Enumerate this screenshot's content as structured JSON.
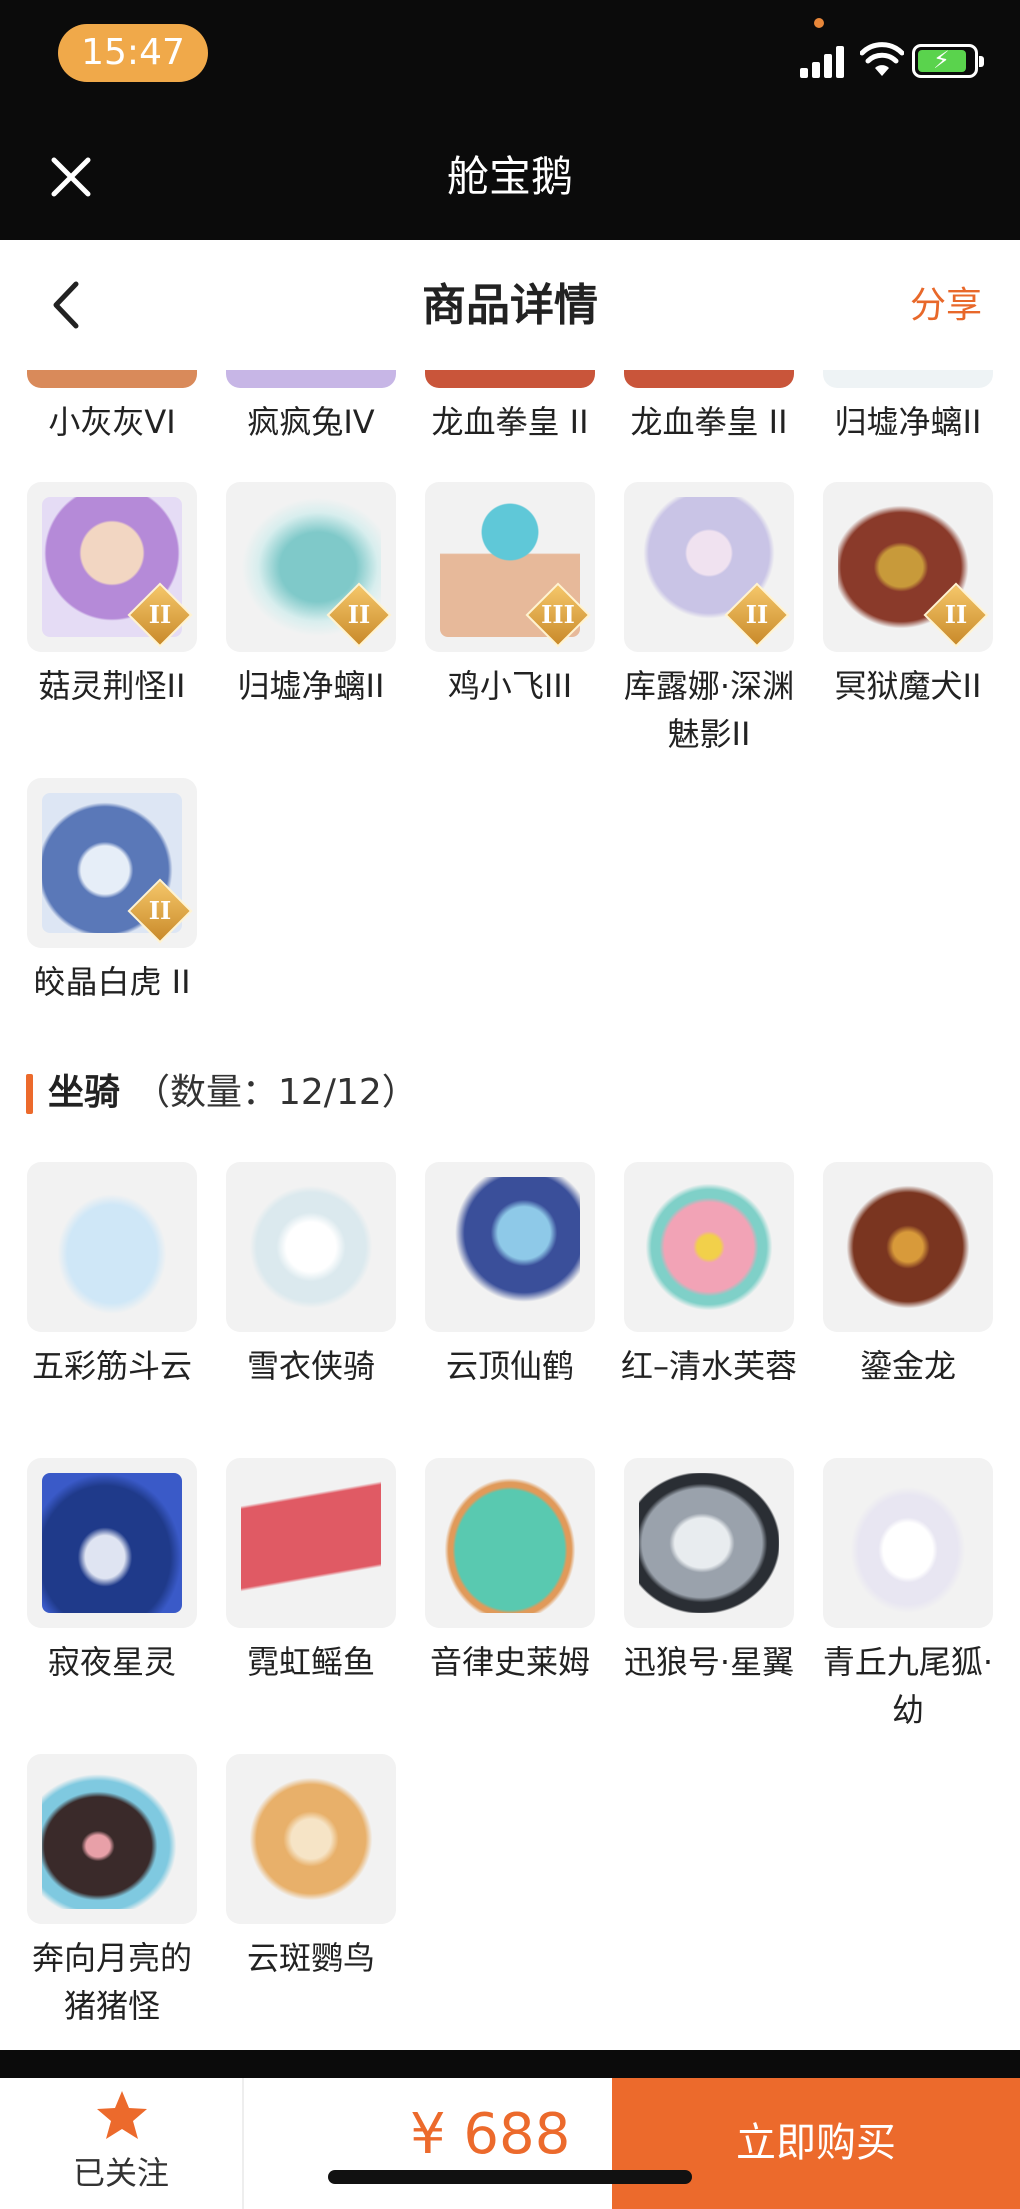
{
  "status_bar": {
    "time": "15:47"
  },
  "mini_program": {
    "title": "舱宝鹅"
  },
  "header": {
    "title": "商品详情",
    "share_label": "分享"
  },
  "top_row_items": [
    {
      "name": "小灰灰VI"
    },
    {
      "name": "疯疯兔IV"
    },
    {
      "name": "龙血拳皇 II"
    },
    {
      "name": "龙血拳皇 II"
    },
    {
      "name": "归墟净螭II"
    }
  ],
  "pet_items": [
    {
      "name": "菇灵荆怪II",
      "badge": "II",
      "color": "#b58ad8"
    },
    {
      "name": "归墟净螭II",
      "badge": "II",
      "color": "#7fc9c9"
    },
    {
      "name": "鸡小飞III",
      "badge": "III",
      "color": "#e7b99a"
    },
    {
      "name": "库露娜·深渊魅影II",
      "badge": "II",
      "color": "#c9c4e6"
    },
    {
      "name": "冥狱魔犬II",
      "badge": "II",
      "color": "#8a3a2a"
    },
    {
      "name": "皎晶白虎 II",
      "badge": "II",
      "color": "#5a78b8"
    }
  ],
  "mount_section": {
    "title": "坐骑",
    "count_text": "（数量：12/12）"
  },
  "mount_items": [
    {
      "name": "五彩筋斗云",
      "color": "#cfe7f7"
    },
    {
      "name": "雪衣侠骑",
      "color": "#dbe9ee"
    },
    {
      "name": "云顶仙鹤",
      "color": "#3a4f9a"
    },
    {
      "name": "红–清水芙蓉",
      "color": "#f2a3b6"
    },
    {
      "name": "鎏金龙",
      "color": "#7a3520"
    },
    {
      "name": "寂夜星灵",
      "color": "#1f3a8a"
    },
    {
      "name": "霓虹鳐鱼",
      "color": "#e05a64"
    },
    {
      "name": "音律史莱姆",
      "color": "#59c9b0"
    },
    {
      "name": "迅狼号·星翼",
      "color": "#9aa2ac"
    },
    {
      "name": "青丘九尾狐·幼",
      "color": "#e8e6f2"
    },
    {
      "name": "奔向月亮的猪猪怪",
      "color": "#3a2a2a"
    },
    {
      "name": "云斑鹦鸟",
      "color": "#e8b06a"
    }
  ],
  "footer": {
    "follow_label": "已关注",
    "price": "¥ 688",
    "buy_label": "立即购买"
  }
}
